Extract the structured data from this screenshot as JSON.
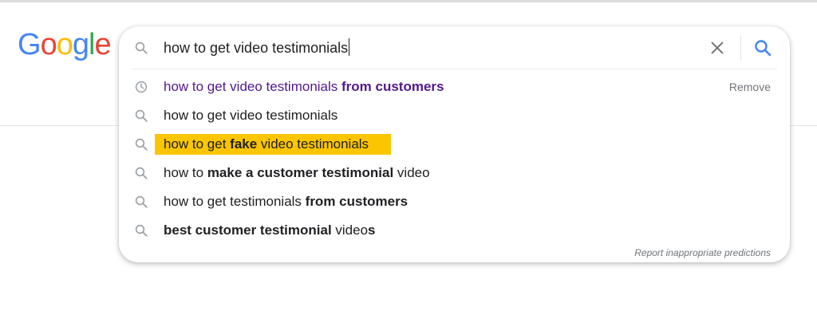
{
  "logo": {
    "letters": [
      {
        "char": "G",
        "color": "#4285F4"
      },
      {
        "char": "o",
        "color": "#EA4335"
      },
      {
        "char": "o",
        "color": "#FBBC05"
      },
      {
        "char": "g",
        "color": "#4285F4"
      },
      {
        "char": "l",
        "color": "#34A853"
      },
      {
        "char": "e",
        "color": "#EA4335"
      }
    ]
  },
  "search": {
    "query": "how to get video testimonials",
    "clear_icon": "close-icon",
    "submit_icon": "search-icon"
  },
  "suggestions": [
    {
      "type": "history",
      "icon": "history-clock-icon",
      "parts": [
        {
          "text": "how to get video testimonials ",
          "bold": false
        },
        {
          "text": "from customers",
          "bold": true
        }
      ],
      "action_label": "Remove"
    },
    {
      "type": "search",
      "icon": "search-icon",
      "parts": [
        {
          "text": "how to get video testimonials",
          "bold": false
        }
      ]
    },
    {
      "type": "search",
      "icon": "search-icon",
      "highlighted": true,
      "highlight_color": "#fbc500",
      "parts": [
        {
          "text": "how to get ",
          "bold": false
        },
        {
          "text": "fake",
          "bold": true
        },
        {
          "text": " video testimonials",
          "bold": false
        }
      ]
    },
    {
      "type": "search",
      "icon": "search-icon",
      "parts": [
        {
          "text": "how to ",
          "bold": false
        },
        {
          "text": "make a customer testimonial",
          "bold": true
        },
        {
          "text": " video",
          "bold": false
        }
      ]
    },
    {
      "type": "search",
      "icon": "search-icon",
      "parts": [
        {
          "text": "how to get testimonials ",
          "bold": false
        },
        {
          "text": "from customers",
          "bold": true
        }
      ]
    },
    {
      "type": "search",
      "icon": "search-icon",
      "parts": [
        {
          "text": "best customer testimonial",
          "bold": true
        },
        {
          "text": " video",
          "bold": false
        },
        {
          "text": "s",
          "bold": true
        }
      ]
    }
  ],
  "footer": {
    "report_label": "Report inappropriate predictions"
  },
  "colors": {
    "history_text": "#52188c",
    "text": "#202124",
    "muted": "#70757a",
    "accent_blue": "#4285F4"
  }
}
